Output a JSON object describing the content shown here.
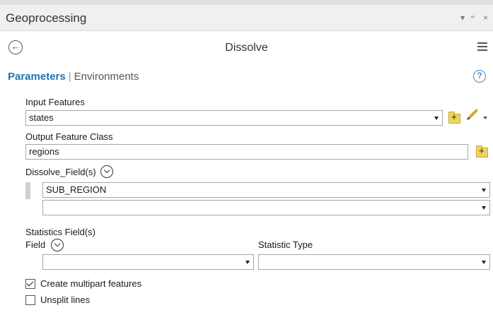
{
  "window": {
    "title": "Geoprocessing",
    "controls": {
      "dropdown": "▾",
      "pin": "ᵸ",
      "close": "×"
    }
  },
  "tool": {
    "title": "Dissolve"
  },
  "tabs": {
    "active": "Parameters",
    "separator": "|",
    "inactive": "Environments"
  },
  "help": {
    "glyph": "?"
  },
  "input_features": {
    "label": "Input Features",
    "value": "states"
  },
  "output_feature_class": {
    "label": "Output Feature Class",
    "value": "regions"
  },
  "dissolve_fields": {
    "label": "Dissolve_Field(s)",
    "rows": [
      "SUB_REGION",
      ""
    ]
  },
  "statistics": {
    "label": "Statistics Field(s)",
    "field_label": "Field",
    "stat_type_label": "Statistic Type",
    "field_value": "",
    "stat_type_value": ""
  },
  "options": {
    "multipart": {
      "label": "Create multipart features",
      "checked": true
    },
    "unsplit": {
      "label": "Unsplit lines",
      "checked": false
    }
  },
  "colors": {
    "accent": "#1e73b5",
    "help": "#3a8fd8",
    "folder": "#f1d35d"
  },
  "icons": [
    "back-arrow-icon",
    "hamburger-menu-icon",
    "help-icon",
    "add-folder-icon",
    "pencil-icon",
    "expand-chevron-icon"
  ]
}
